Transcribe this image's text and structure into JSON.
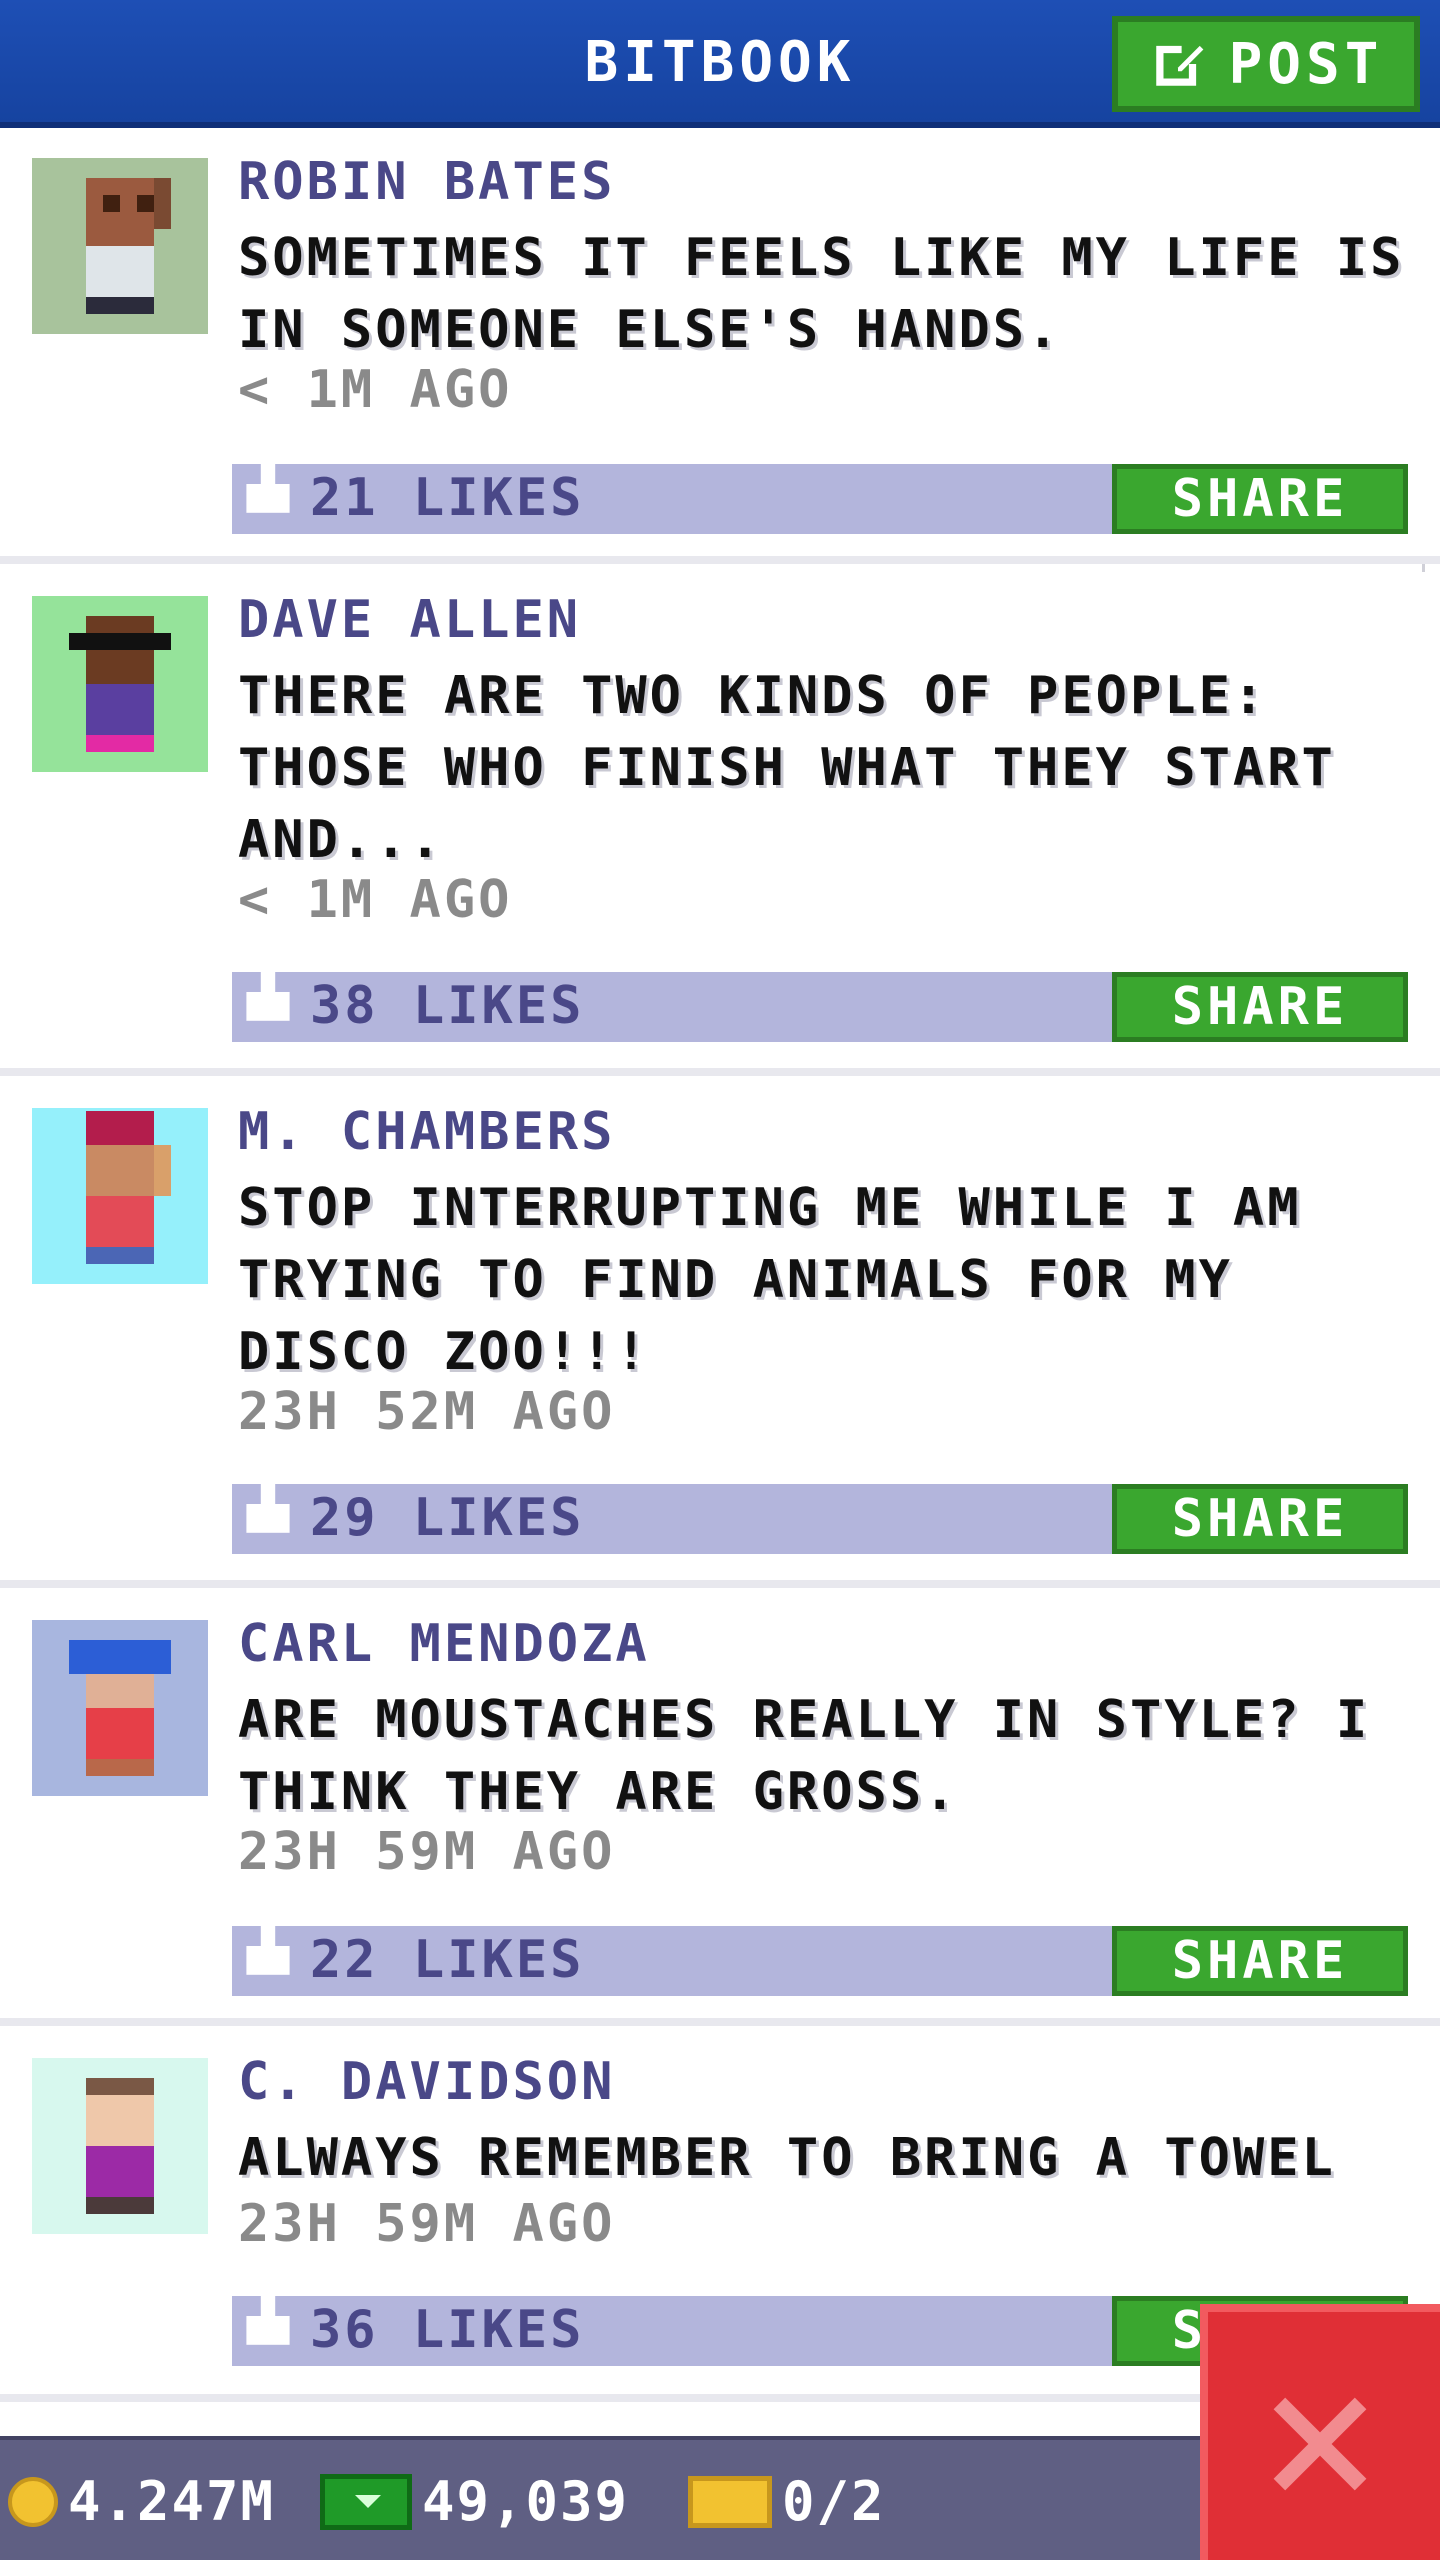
{
  "header": {
    "title": "BITBOOK",
    "post_label": "POST"
  },
  "posts": [
    {
      "author": "ROBIN BATES",
      "text": "SOMETIMES IT FEELS LIKE MY LIFE IS IN SOMEONE ELSE'S HANDS.",
      "time": "< 1M AGO",
      "likes": "21 LIKES",
      "share_label": "SHARE",
      "avatar_bg": "#a8c39c"
    },
    {
      "author": "DAVE ALLEN",
      "text": "THERE ARE TWO KINDS OF PEOPLE: THOSE WHO FINISH WHAT THEY START AND...",
      "time": "< 1M AGO",
      "likes": "38 LIKES",
      "share_label": "SHARE",
      "avatar_bg": "#95e39a"
    },
    {
      "author": "M. CHAMBERS",
      "text": "STOP INTERRUPTING ME WHILE I AM TRYING TO FIND ANIMALS FOR MY DISCO ZOO!!!",
      "time": "23H 52M AGO",
      "likes": "29 LIKES",
      "share_label": "SHARE",
      "avatar_bg": "#95f0fb"
    },
    {
      "author": "CARL MENDOZA",
      "text": "ARE MOUSTACHES REALLY IN STYLE? I THINK THEY ARE GROSS.",
      "time": "23H 59M AGO",
      "likes": "22 LIKES",
      "share_label": "SHARE",
      "avatar_bg": "#a8b6df"
    },
    {
      "author": "C. DAVIDSON",
      "text": "ALWAYS REMEMBER TO BRING A TOWEL",
      "time": "23H 59M AGO",
      "likes": "36 LIKES",
      "share_label": "SHARE",
      "avatar_bg": "#d7f8ee"
    }
  ],
  "status": {
    "coins": "4.247M",
    "bux": "49,039",
    "tickets": "0/2"
  },
  "colors": {
    "header_bg": "#1e4fb5",
    "button_green": "#3aa72f",
    "like_bar": "#b3b5dc",
    "name_text": "#4a4888",
    "close_red": "#e02f36"
  },
  "icons": [
    "edit-icon",
    "thumbs-up-icon",
    "coin-icon",
    "bux-icon",
    "ticket-icon",
    "close-icon"
  ]
}
